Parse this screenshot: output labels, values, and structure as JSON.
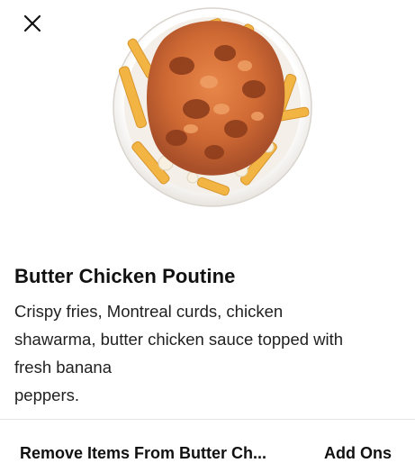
{
  "header": {
    "close_icon": "close-icon"
  },
  "item": {
    "image_icon": "butter-chicken-poutine-photo",
    "title": "Butter Chicken Poutine",
    "description_lines": [
      "Crispy fries, Montreal curds, chicken",
      "shawarma, butter chicken sauce topped with",
      "fresh banana",
      "peppers."
    ]
  },
  "tabs": [
    {
      "label": "Remove Items From Butter Ch..."
    },
    {
      "label": "Add Ons"
    }
  ],
  "colors": {
    "background": "#ffffff",
    "text": "#111111",
    "divider": "#e3e3e3"
  }
}
